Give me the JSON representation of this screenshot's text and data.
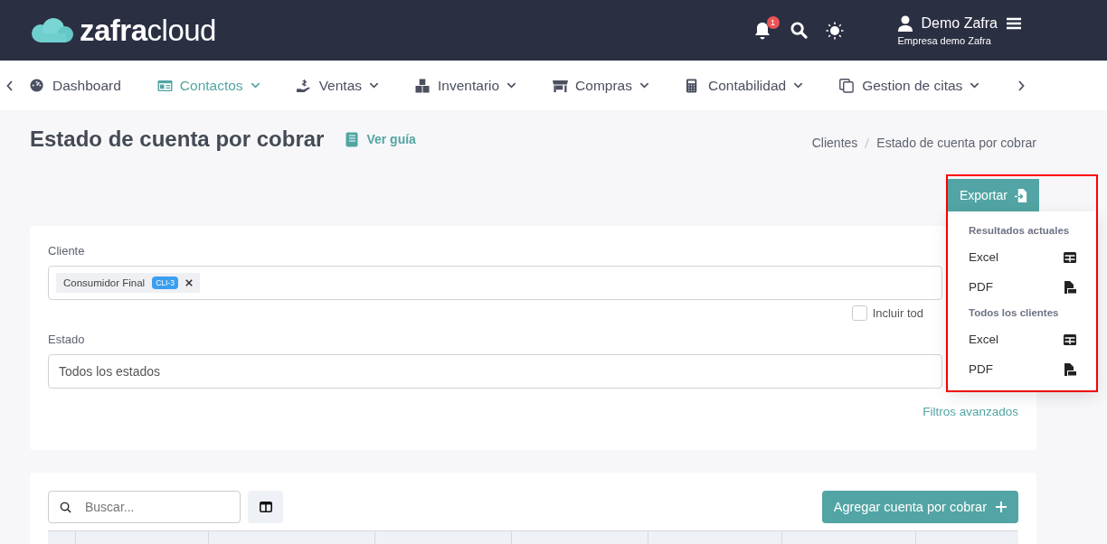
{
  "header": {
    "logo": {
      "word_bold": "zafra",
      "word_light": "cloud"
    },
    "notifications": {
      "count": "1"
    },
    "user": {
      "name": "Demo Zafra",
      "company": "Empresa demo Zafra"
    }
  },
  "nav": {
    "items": [
      {
        "label": "Dashboard",
        "selected": false,
        "dropdown": false
      },
      {
        "label": "Contactos",
        "selected": true,
        "dropdown": true
      },
      {
        "label": "Ventas",
        "selected": false,
        "dropdown": true
      },
      {
        "label": "Inventario",
        "selected": false,
        "dropdown": true
      },
      {
        "label": "Compras",
        "selected": false,
        "dropdown": true
      },
      {
        "label": "Contabilidad",
        "selected": false,
        "dropdown": true
      },
      {
        "label": "Gestion de citas",
        "selected": false,
        "dropdown": true
      }
    ]
  },
  "page": {
    "title": "Estado de cuenta por cobrar",
    "guide_link": "Ver guía",
    "breadcrumb": [
      "Clientes",
      "Estado de cuenta por cobrar"
    ]
  },
  "export": {
    "label": "Exportar",
    "menu_highlighted": true,
    "menu": [
      {
        "kind": "header",
        "label": "Resultados actuales"
      },
      {
        "kind": "excel",
        "label": "Excel"
      },
      {
        "kind": "pdf",
        "label": "PDF"
      },
      {
        "kind": "header",
        "label": "Todos los clientes"
      },
      {
        "kind": "excel",
        "label": "Excel"
      },
      {
        "kind": "pdf",
        "label": "PDF"
      }
    ]
  },
  "filters": {
    "client_label": "Cliente",
    "client_tags": [
      {
        "name": "Consumidor Final",
        "code": "CLI-3"
      }
    ],
    "include_all": {
      "label": "Incluir tod",
      "checked": false
    },
    "status_label": "Estado",
    "status_value": "Todos los estados",
    "advanced_link": "Filtros avanzados"
  },
  "table": {
    "search": {
      "placeholder": "Buscar..."
    },
    "add_button": "Agregar cuenta por cobrar"
  }
}
